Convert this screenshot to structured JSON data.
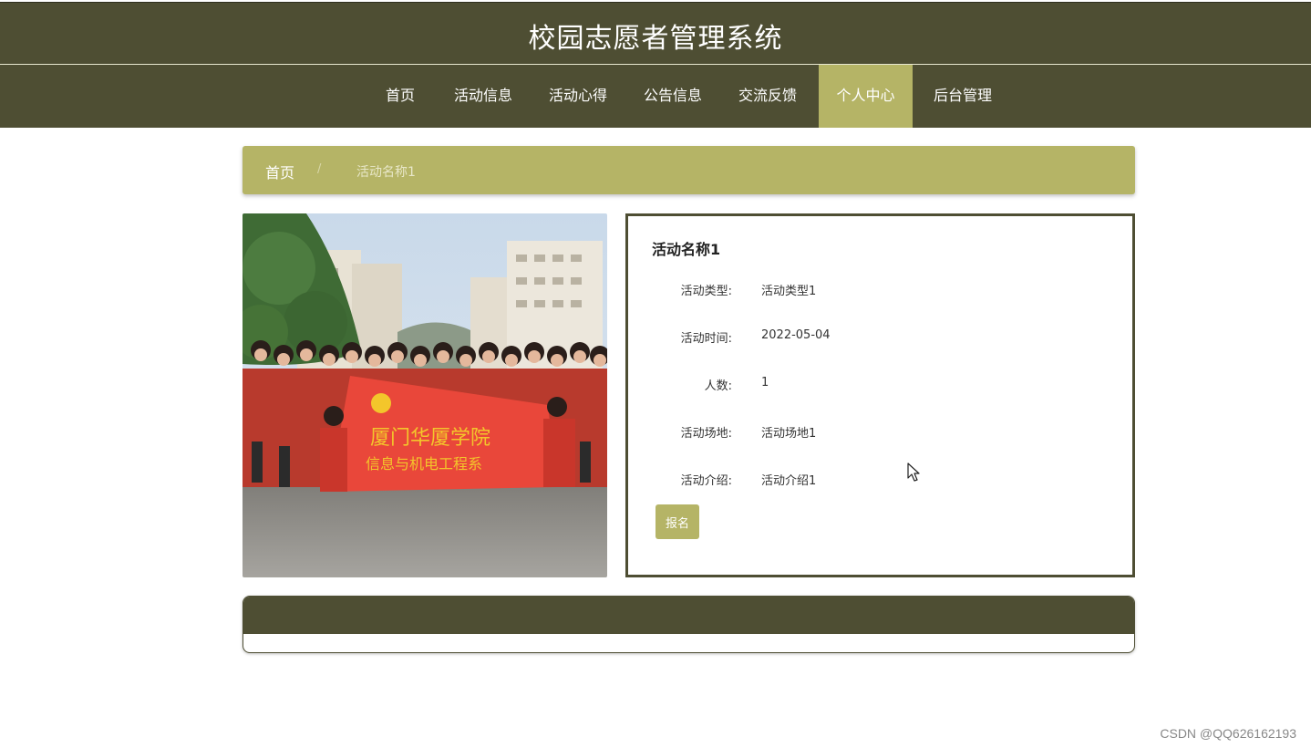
{
  "app": {
    "title": "校园志愿者管理系统"
  },
  "nav": {
    "items": [
      {
        "label": "首页",
        "active": false
      },
      {
        "label": "活动信息",
        "active": false
      },
      {
        "label": "活动心得",
        "active": false
      },
      {
        "label": "公告信息",
        "active": false
      },
      {
        "label": "交流反馈",
        "active": false
      },
      {
        "label": "个人中心",
        "active": true
      },
      {
        "label": "后台管理",
        "active": false
      }
    ]
  },
  "breadcrumb": {
    "home": "首页",
    "separator": "/",
    "current": "活动名称1"
  },
  "activity": {
    "name": "活动名称1",
    "fields": [
      {
        "label": "活动类型:",
        "value": "活动类型1"
      },
      {
        "label": "活动时间:",
        "value": "2022-05-04"
      },
      {
        "label": "人数:",
        "value": "1"
      },
      {
        "label": "活动场地:",
        "value": "活动场地1"
      },
      {
        "label": "活动介绍:",
        "value": "活动介绍1"
      }
    ],
    "signup_label": "报名",
    "photo": {
      "banner_line1": "厦门华厦学院",
      "banner_line2": "信息与机电工程系"
    }
  },
  "colors": {
    "primary": "#4e4e33",
    "accent": "#b5b466"
  },
  "watermark": "CSDN @QQ626162193"
}
